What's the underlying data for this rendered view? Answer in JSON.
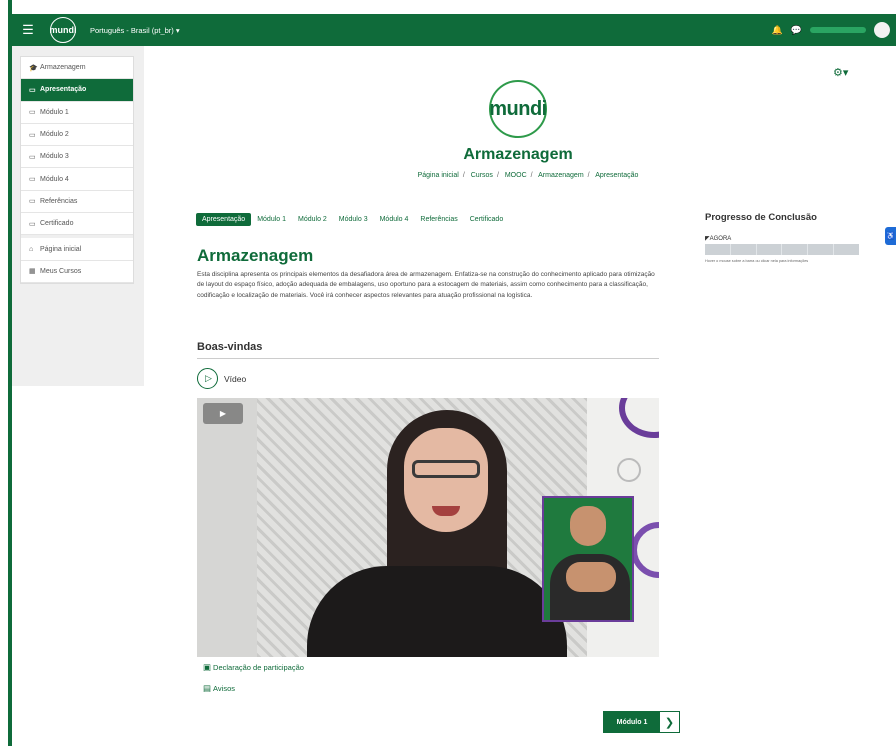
{
  "topbar": {
    "menu_icon": "hamburger-icon",
    "logo_text": "mundi",
    "language": "Português - Brasil (pt_br) ▾",
    "bell_icon": "bell-icon",
    "chat_icon": "chat-icon"
  },
  "sidebar": {
    "items": [
      {
        "label": "Armazenagem",
        "icon": "graduation-cap-icon"
      },
      {
        "label": "Apresentação",
        "icon": "folder-icon"
      },
      {
        "label": "Módulo 1",
        "icon": "folder-icon"
      },
      {
        "label": "Módulo 2",
        "icon": "folder-icon"
      },
      {
        "label": "Módulo 3",
        "icon": "folder-icon"
      },
      {
        "label": "Módulo 4",
        "icon": "folder-icon"
      },
      {
        "label": "Referências",
        "icon": "folder-icon"
      },
      {
        "label": "Certificado",
        "icon": "folder-icon"
      }
    ],
    "nav": [
      {
        "label": "Página inicial",
        "icon": "home-icon"
      },
      {
        "label": "Meus Cursos",
        "icon": "courses-icon"
      }
    ]
  },
  "header": {
    "logo_text": "mundi",
    "course_title": "Armazenagem",
    "breadcrumb": [
      "Página inicial",
      "Cursos",
      "MOOC",
      "Armazenagem",
      "Apresentação"
    ]
  },
  "tabs": [
    "Apresentação",
    "Módulo 1",
    "Módulo 2",
    "Módulo 3",
    "Módulo 4",
    "Referências",
    "Certificado"
  ],
  "main": {
    "title": "Armazenagem",
    "description": "Esta disciplina apresenta os principais elementos da desafiadora área de armazenagem. Enfatiza-se na construção do conhecimento aplicado para otimização de layout do espaço físico, adoção adequada de embalagens, uso oportuno para a estocagem de materiais, assim como conhecimento para a classificação, codificação e localização de materiais. Você irá conhecer aspectos relevantes para atuação profissional na logística.",
    "section_title": "Boas-vindas",
    "video_label": "Vídeo",
    "links": [
      {
        "label": "Declaração de participação",
        "icon": "certificate-icon"
      },
      {
        "label": "Avisos",
        "icon": "forum-icon"
      }
    ],
    "next_button": "Módulo 1"
  },
  "progress": {
    "title": "Progresso de Conclusão",
    "label": "AGORA",
    "help": "Hover o mouse sobre a barra ou clicar nela para informações",
    "value": 0
  },
  "colors": {
    "brand": "#0f6b3a",
    "accent_purple": "#6a3d9a",
    "accessibility": "#1e6bd6"
  }
}
